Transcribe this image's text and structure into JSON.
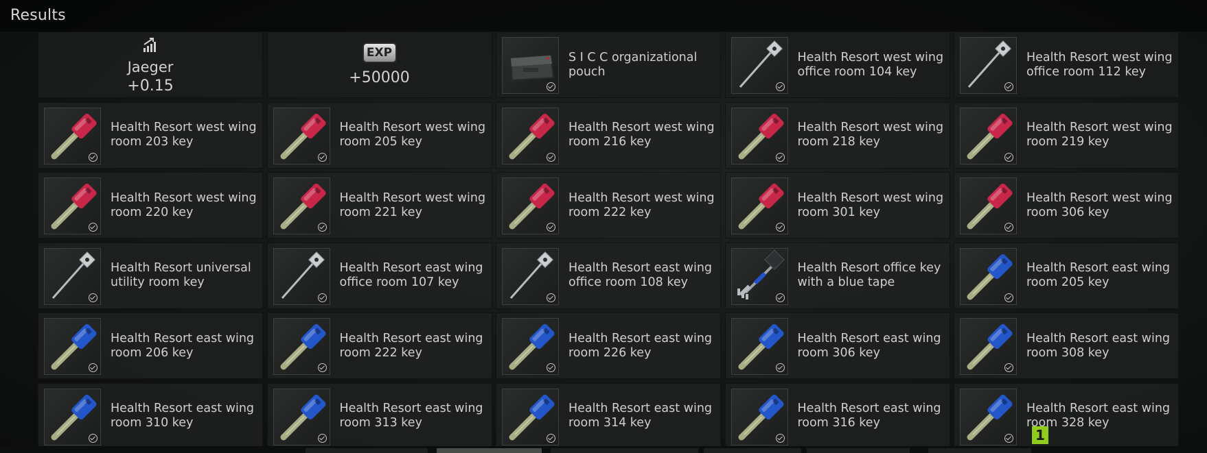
{
  "header": {
    "title": "Results"
  },
  "rewards_top": [
    {
      "type": "standing",
      "icon": "standing-up-icon",
      "name": "Jaeger",
      "value": "+0.15"
    },
    {
      "type": "exp",
      "icon": "exp-badge-icon",
      "badge": "EXP",
      "value": "+50000"
    },
    {
      "type": "item",
      "icon": "pouch-icon",
      "name": "S I C C organizational\npouch",
      "checked": true
    },
    {
      "type": "item",
      "icon": "silver-key-icon",
      "name": "Health Resort west wing\noffice room 104 key",
      "checked": true
    },
    {
      "type": "item",
      "icon": "silver-key-icon",
      "name": "Health Resort west wing\noffice room 112 key",
      "checked": true
    }
  ],
  "items": [
    {
      "icon": "red-key-icon",
      "name": "Health Resort west wing\nroom 203 key"
    },
    {
      "icon": "red-key-icon",
      "name": "Health Resort west wing\nroom 205 key"
    },
    {
      "icon": "red-key-icon",
      "name": "Health Resort west wing\nroom 216 key"
    },
    {
      "icon": "red-key-icon",
      "name": "Health Resort west wing\nroom 218 key"
    },
    {
      "icon": "red-key-icon",
      "name": "Health Resort west wing\nroom 219 key"
    },
    {
      "icon": "red-key-icon",
      "name": "Health Resort west wing\nroom 220 key"
    },
    {
      "icon": "red-key-icon",
      "name": "Health Resort west wing\nroom 221 key"
    },
    {
      "icon": "red-key-icon",
      "name": "Health Resort west wing\nroom 222 key"
    },
    {
      "icon": "red-key-icon",
      "name": "Health Resort west wing\nroom 301 key"
    },
    {
      "icon": "red-key-icon",
      "name": "Health Resort west wing\nroom 306 key"
    },
    {
      "icon": "silver-key-icon",
      "name": "Health Resort universal\nutility room key"
    },
    {
      "icon": "silver-key-icon",
      "name": "Health Resort east wing\noffice room 107 key"
    },
    {
      "icon": "silver-key-icon",
      "name": "Health Resort east wing\noffice room 108 key"
    },
    {
      "icon": "blue-tape-key-icon",
      "name": "Health Resort office key\nwith a blue tape"
    },
    {
      "icon": "blue-key-icon",
      "name": "Health Resort east wing\nroom 205 key"
    },
    {
      "icon": "blue-key-icon",
      "name": "Health Resort east wing\nroom 206 key"
    },
    {
      "icon": "blue-key-icon",
      "name": "Health Resort east wing\nroom 222 key"
    },
    {
      "icon": "blue-key-icon",
      "name": "Health Resort east wing\nroom 226 key"
    },
    {
      "icon": "blue-key-icon",
      "name": "Health Resort east wing\nroom 306 key"
    },
    {
      "icon": "blue-key-icon",
      "name": "Health Resort east wing\nroom 308 key"
    },
    {
      "icon": "blue-key-icon",
      "name": "Health Resort east wing\nroom 310 key"
    },
    {
      "icon": "blue-key-icon",
      "name": "Health Resort east wing\nroom 313 key"
    },
    {
      "icon": "blue-key-icon",
      "name": "Health Resort east wing\nroom 314 key"
    },
    {
      "icon": "blue-key-icon",
      "name": "Health Resort east wing\nroom 316 key"
    },
    {
      "icon": "blue-key-icon",
      "name": "Health Resort east wing\nroom 328 key"
    }
  ],
  "count_badge": "1",
  "colors": {
    "red_key": "#c8274a",
    "blue_key": "#2356c9",
    "key_shaft": "#a9ad86",
    "badge_green": "#8fcc1d"
  }
}
